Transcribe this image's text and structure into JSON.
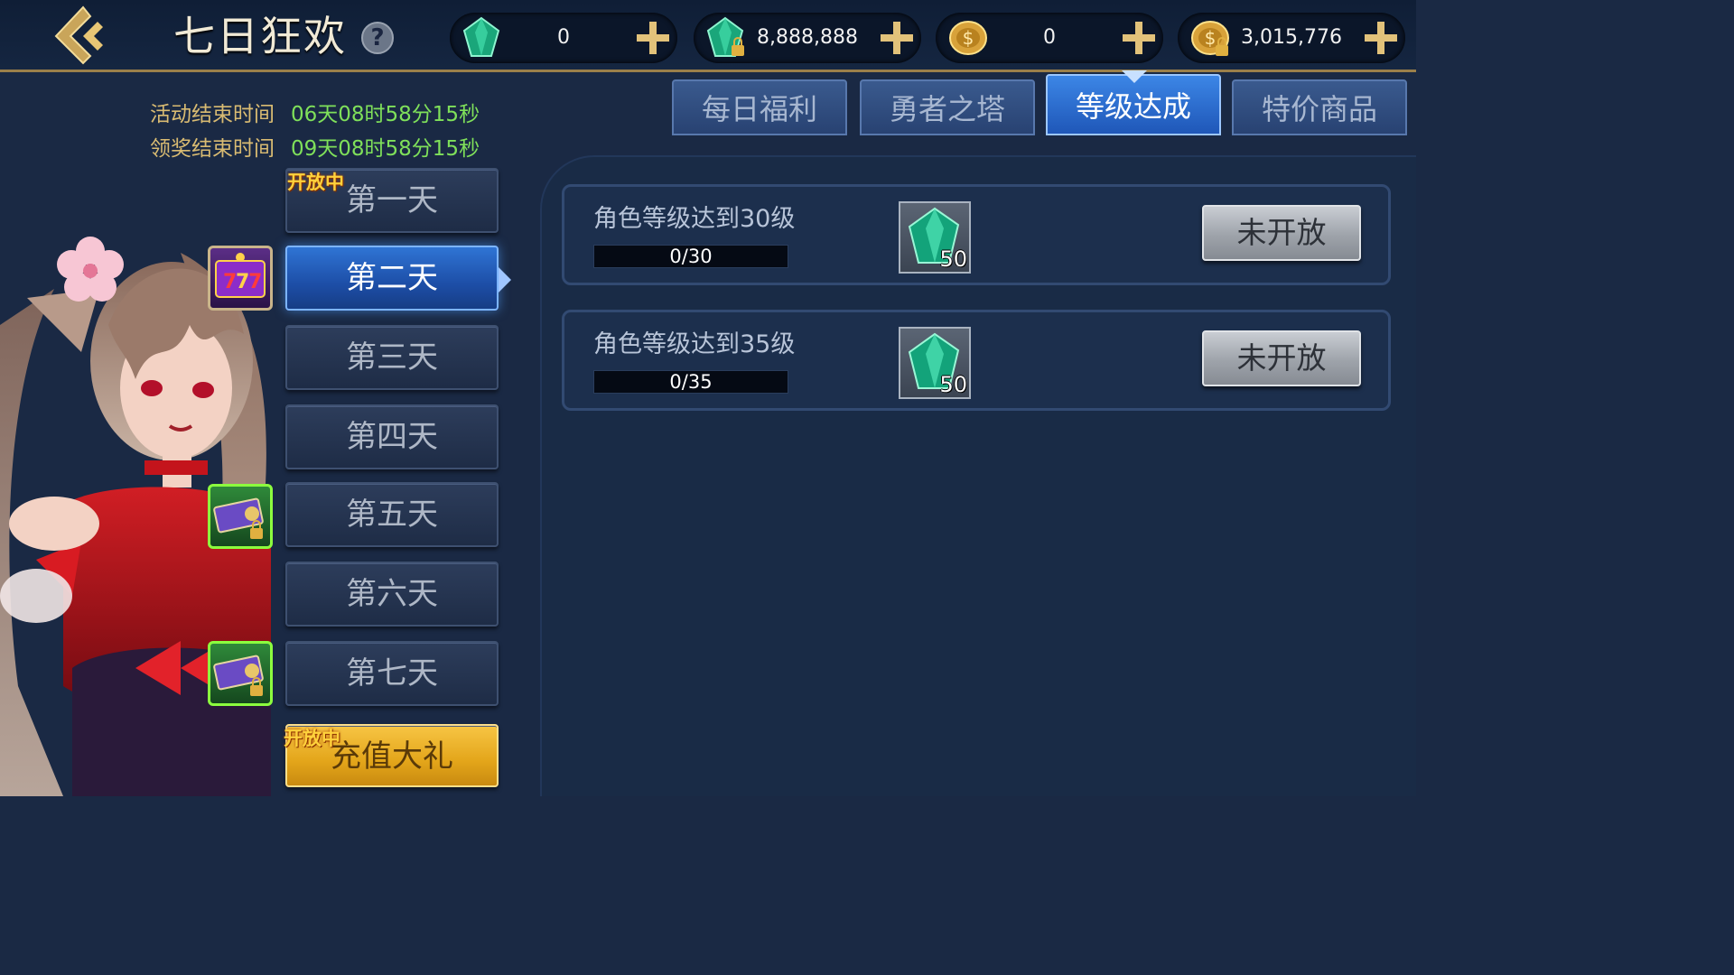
{
  "header": {
    "title": "七日狂欢",
    "help_symbol": "?",
    "currencies": [
      {
        "icon": "green-gem-icon",
        "value": "0"
      },
      {
        "icon": "locked-green-gem-icon",
        "value": "8,888,888"
      },
      {
        "icon": "gold-coin-icon",
        "value": "0"
      },
      {
        "icon": "locked-gold-coin-icon",
        "value": "3,015,776"
      }
    ]
  },
  "timers": {
    "event_end_label": "活动结束时间",
    "event_end_value": "06天08时58分15秒",
    "claim_end_label": "领奖结束时间",
    "claim_end_value": "09天08时58分15秒"
  },
  "days": [
    {
      "label": "第一天",
      "tag": "开放中"
    },
    {
      "label": "第二天"
    },
    {
      "label": "第三天"
    },
    {
      "label": "第四天"
    },
    {
      "label": "第五天"
    },
    {
      "label": "第六天"
    },
    {
      "label": "第七天"
    },
    {
      "label": "充值大礼",
      "tag": "开放中"
    }
  ],
  "tabs": [
    "每日福利",
    "勇者之塔",
    "等级达成",
    "特价商品"
  ],
  "tasks": [
    {
      "title": "角色等级达到30级",
      "progress": "0/30",
      "reward_icon": "green-gem-icon",
      "reward_count": "50",
      "button": "未开放"
    },
    {
      "title": "角色等级达到35级",
      "progress": "0/35",
      "reward_icon": "green-gem-icon",
      "reward_count": "50",
      "button": "未开放"
    }
  ],
  "colors": {
    "accent_blue": "#2f74d4",
    "timer_green": "#7fe05a",
    "label_gold": "#d9bb72",
    "open_tag": "#ffd23c"
  }
}
